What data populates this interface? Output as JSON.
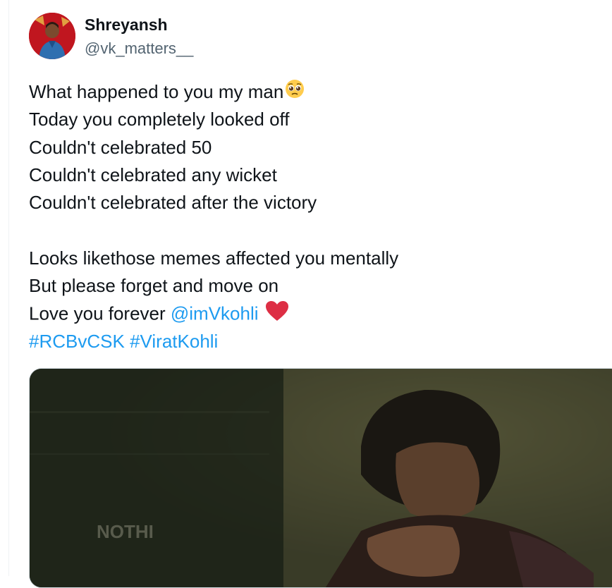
{
  "tweet": {
    "author": {
      "name": "Shreyansh",
      "handle": "@vk_matters__"
    },
    "lines": [
      "What happened to you my man",
      "Today you completely looked off",
      "Couldn't celebrated 50",
      "Couldn't celebrated any wicket",
      "Couldn't celebrated after the victory",
      "Looks likethose memes affected you mentally",
      "But please forget and move on",
      "Love you forever "
    ],
    "mention": "@imVkohli",
    "hashtags": [
      "#RCBvCSK",
      "#ViratKohli"
    ],
    "emojis": {
      "pleading": "pleading-face-icon",
      "heart": "red-heart-icon"
    },
    "media": {
      "overlay_text": "NOTHI"
    }
  },
  "colors": {
    "link": "#1d9bf0",
    "text": "#0f1419",
    "secondary": "#536471",
    "heart": "#f91880"
  }
}
